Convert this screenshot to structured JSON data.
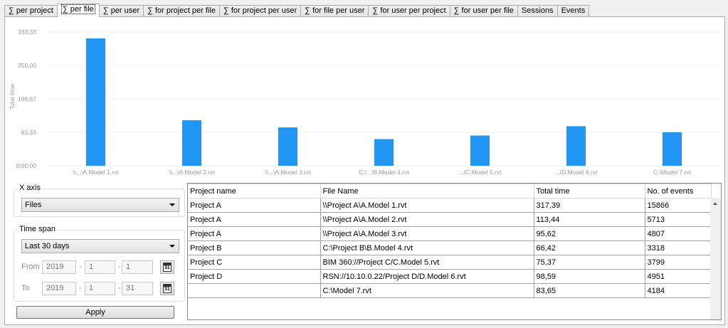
{
  "tabs": [
    {
      "label": "∑ per project",
      "active": false
    },
    {
      "label": "∑ per file",
      "active": true
    },
    {
      "label": "∑ per user",
      "active": false
    },
    {
      "label": "∑ for project per file",
      "active": false
    },
    {
      "label": "∑ for project per user",
      "active": false
    },
    {
      "label": "∑ for file per user",
      "active": false
    },
    {
      "label": "∑ for user per project",
      "active": false
    },
    {
      "label": "∑ for user per file",
      "active": false
    },
    {
      "label": "Sessions",
      "active": false
    },
    {
      "label": "Events",
      "active": false
    }
  ],
  "chart_data": {
    "type": "bar",
    "ylabel": "Total time",
    "yticks": [
      "0:00:00",
      "83,33",
      "166,67",
      "250,00",
      "333,33"
    ],
    "ytick_values": [
      0,
      83.33,
      166.67,
      250.0,
      333.33
    ],
    "ylim": [
      0,
      333.33
    ],
    "categories": [
      "\\\\...\\A.Model 1.rvt",
      "\\\\...\\A.Model 2.rvt",
      "\\\\...\\A.Model 3.rvt",
      "C:\\...\\B.Model 4.rvt",
      ".../C.Model 5.rvt",
      ".../D.Model 6.rvt",
      "C:\\Model 7.rvt"
    ],
    "values": [
      317.39,
      113.44,
      95.62,
      66.42,
      75.37,
      98.59,
      83.65
    ],
    "bar_color": "#2196f3",
    "grid": true
  },
  "controls": {
    "x_axis": {
      "title": "X axis",
      "selected": "Files"
    },
    "time_span": {
      "title": "Time span",
      "selected": "Last 30 days",
      "from_label": "From",
      "to_label": "To",
      "from": {
        "year": "2019",
        "month": "1",
        "day": "1"
      },
      "to": {
        "year": "2019",
        "month": "1",
        "day": "31"
      },
      "calendar_glyph": "31"
    },
    "apply_label": "Apply"
  },
  "table": {
    "columns": [
      "Project name",
      "File Name",
      "Total time",
      "No. of events"
    ],
    "rows": [
      [
        "Project A",
        "\\\\Project A\\A.Model 1.rvt",
        "317,39",
        "15866"
      ],
      [
        "Project A",
        "\\\\Project A\\A.Model 2.rvt",
        "113,44",
        "5713"
      ],
      [
        "Project A",
        "\\\\Project A\\A.Model 3.rvt",
        "95,62",
        "4807"
      ],
      [
        "Project B",
        "C:\\Project B\\B.Model 4.rvt",
        "66,42",
        "3318"
      ],
      [
        "Project C",
        "BIM 360://Project C/C.Model 5.rvt",
        "75,37",
        "3799"
      ],
      [
        "Project D",
        "RSN://10.10.0.22/Project D/D.Model 6.rvt",
        "98,59",
        "4951"
      ],
      [
        "",
        "C:\\Model 7.rvt",
        "83,65",
        "4184"
      ]
    ]
  }
}
